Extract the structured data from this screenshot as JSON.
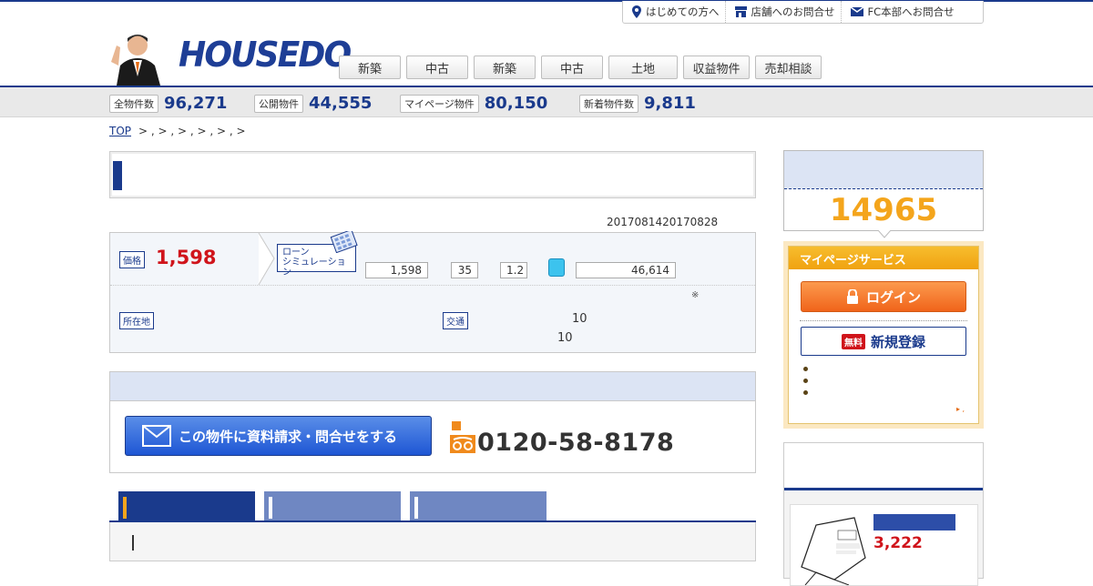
{
  "header": {
    "logo_text": "HOUSEDO",
    "top_links": [
      {
        "label": "はじめての方へ",
        "icon": "map-pin-icon"
      },
      {
        "label": "店舗へのお問合せ",
        "icon": "store-icon"
      },
      {
        "label": "FC本部へお問合せ",
        "icon": "mail-icon"
      }
    ],
    "nav": [
      "新築",
      "中古",
      "新築",
      "中古",
      "土地",
      "収益物件",
      "売却相談"
    ]
  },
  "stats": [
    {
      "label": "全物件数",
      "value": "96,271"
    },
    {
      "label": "公開物件",
      "value": "44,555"
    },
    {
      "label": "マイページ物件",
      "value": "80,150"
    },
    {
      "label": "新着物件数",
      "value": "9,811"
    }
  ],
  "breadcrumb": {
    "top": "TOP",
    "trail": ">  , >  , >  , >  , >  , >"
  },
  "property": {
    "dates": "2017081420170828",
    "price_label": "価格",
    "price": "1,598",
    "loan_label_1": "ローン",
    "loan_label_2": "シミュレーション",
    "loan_inputs": [
      "1,598",
      "35",
      "1.2"
    ],
    "monthly": "46,614",
    "note_mark": "※",
    "location_label": "所在地",
    "transit_label": "交通",
    "transit_line1": "10",
    "transit_line2": "10"
  },
  "contact": {
    "request_button": "この物件に資料請求・問合せをする",
    "phone": "0120-58-8178"
  },
  "sidebar": {
    "count": "14965",
    "mypage_title": "マイページサービス",
    "login": "ログイン",
    "free_badge": "無料",
    "register": "新規登録",
    "more_link": "▸ ,",
    "card_price": "3,222"
  },
  "colors": {
    "brand": "#1a3a8c",
    "price": "#d0141b",
    "accent": "#f4a51c",
    "login": "#f0641a"
  }
}
